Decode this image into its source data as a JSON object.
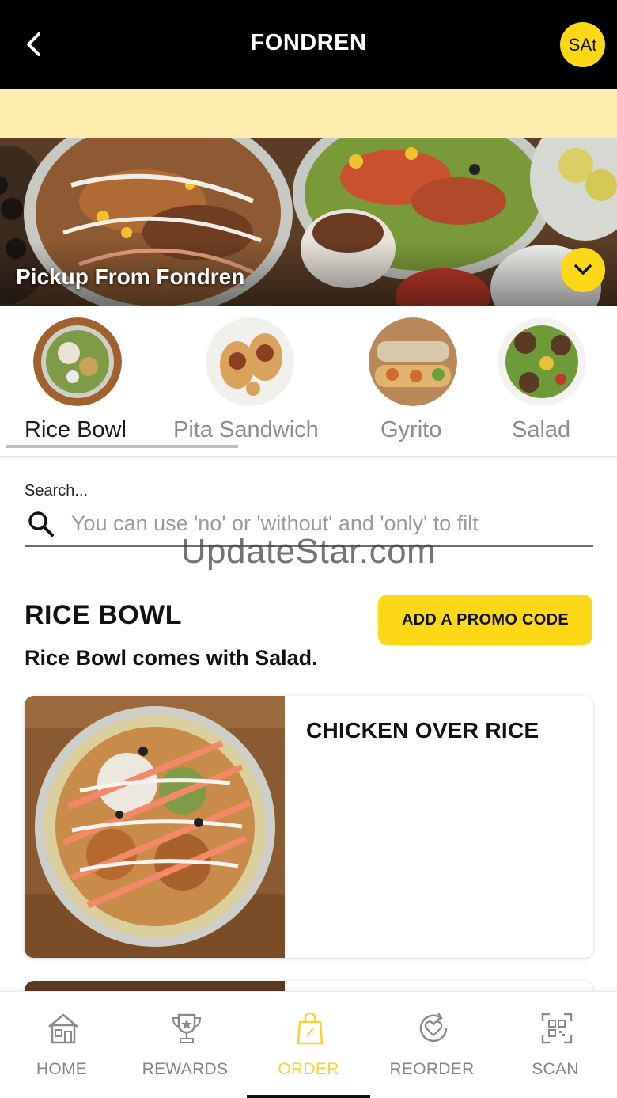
{
  "header": {
    "title": "FONDREN",
    "avatar_initials": "SAt"
  },
  "hero": {
    "title": "Pickup From Fondren"
  },
  "categories": [
    {
      "label": "Rice Bowl",
      "active": true
    },
    {
      "label": "Pita Sandwich",
      "active": false
    },
    {
      "label": "Gyrito",
      "active": false
    },
    {
      "label": "Salad",
      "active": false
    }
  ],
  "search": {
    "label": "Search...",
    "placeholder": "You can use 'no' or 'without' and 'only' to filt",
    "value": ""
  },
  "watermark": "UpdateStar.com",
  "section": {
    "title": "RICE BOWL",
    "subtitle": "Rice Bowl comes with Salad.",
    "promo_button": "ADD A PROMO CODE"
  },
  "items": [
    {
      "name": "CHICKEN OVER RICE"
    }
  ],
  "nav": {
    "items": [
      {
        "label": "HOME",
        "icon": "house-icon"
      },
      {
        "label": "REWARDS",
        "icon": "trophy-icon"
      },
      {
        "label": "ORDER",
        "icon": "shopping-bag-icon"
      },
      {
        "label": "REORDER",
        "icon": "heart-refresh-icon"
      },
      {
        "label": "SCAN",
        "icon": "qr-scan-icon"
      }
    ],
    "active": "ORDER"
  },
  "colors": {
    "brand_yellow": "#fcd817",
    "header_bg": "#000000",
    "notice_bg": "#fdeeb0",
    "nav_active": "#f6d236"
  }
}
